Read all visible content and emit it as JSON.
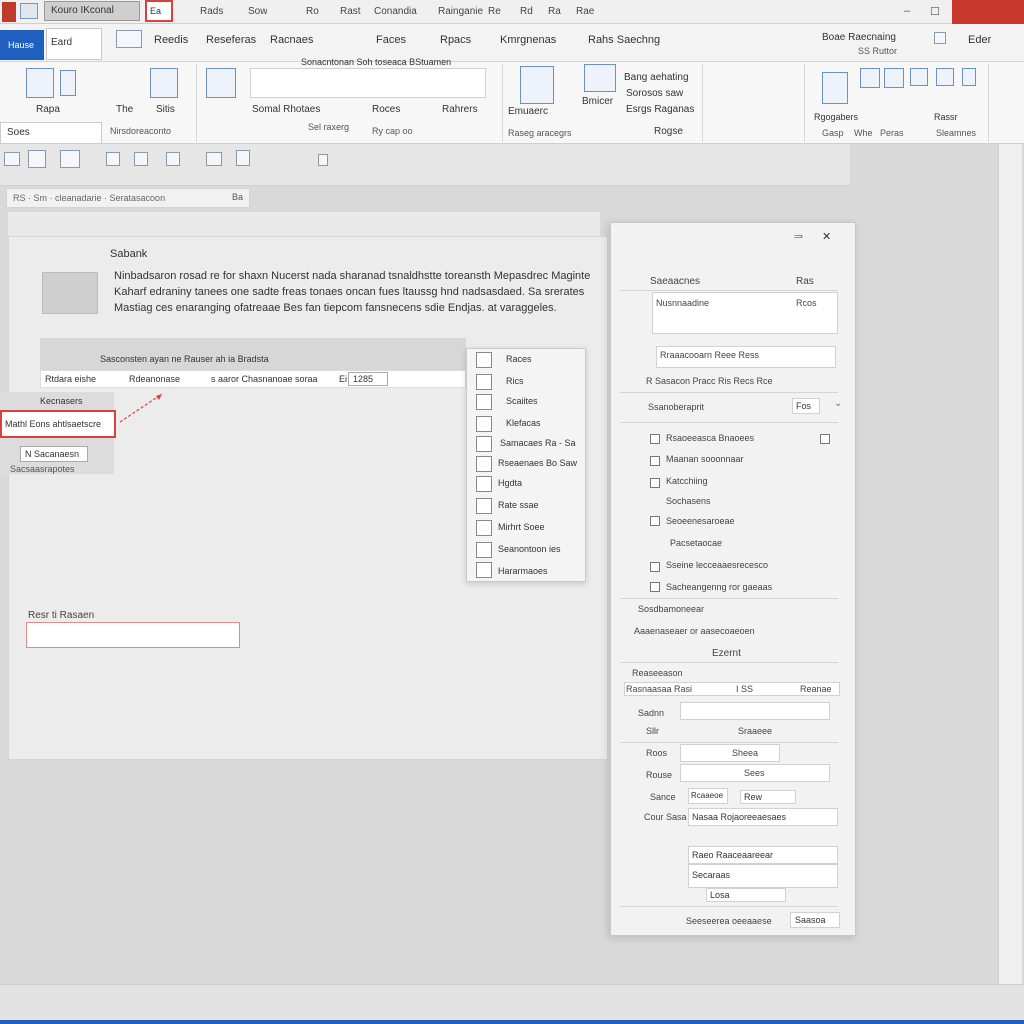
{
  "titlebar": {
    "doc_title": "Kouro IKconal",
    "highlight_btn": "Ea",
    "menus": [
      "Rads",
      "Sow",
      "Ro",
      "Rast",
      "Conandia",
      "Rainganie",
      "Re",
      "Rd",
      "Ra",
      "Rae"
    ],
    "min": "‒",
    "max": "☐"
  },
  "tabs": {
    "file": "Hause",
    "active": "Eard",
    "items": [
      "Reedis",
      "Reseferas",
      "Racnaes",
      "Faces",
      "Rpacs",
      "Kmrgnenas",
      "Rahs Saechng",
      "Eder"
    ],
    "right_group": "Boae Raecnaing",
    "right_sub": "SS Ruttor"
  },
  "ribbon": {
    "labels": [
      "Rapa",
      "The",
      "Sitis",
      "Somal Rhotaes",
      "Roces",
      "Rahrers",
      "Emuaerc",
      "Bmicer",
      "Rgogabers",
      "Rassr"
    ],
    "search": "Soes",
    "bottom_labels": [
      "Nirsdoreaconto",
      "Sel raxerg",
      "Ry cap oo",
      "Raseg aracegrs",
      "Gasp",
      "Whe",
      "Peras",
      "Sleamnes"
    ],
    "center_doc": "Sonacntonan Soh toseaca BStuamen",
    "right_labels": [
      "Bang aehating",
      "Sorosos saw",
      "Esrgs Raganas",
      "Rogse"
    ]
  },
  "toolbar2": {
    "breadcrumb": "RS · Sm · cleanadarie · Seratasacoon",
    "breadcrumb_end": "Ba"
  },
  "document": {
    "heading": "Sabank",
    "paragraphs": [
      "Ninbadsaron rosad re for shaxn Nucerst nada sharanad tsnaldhstte toreansth Mepasdrec Maginte",
      "Kaharf edraniny tanees one sadte freas tonaes oncan fues ltaussg hnd nadsasdaed. Sa srerates",
      "Mastiag ces enaranging ofatreaae Bes fan tiepcom fansnecens sdie Endjas. at varaggeles."
    ],
    "table_header": "Sasconsten ayan ne Rauser ah ia Bradsta",
    "table_row": [
      "Rtdara eishe",
      "Rdeanonase",
      "s aaror Chasnanoae soraa",
      "Ei"
    ],
    "table_value": "1285",
    "sidebox_label": "Kecnasers",
    "selected": "Mathl Eons ahtlsaetscre",
    "sidebox_btn": "N Sacanaesn",
    "sidebox_foot": "Sacsaasrapotes",
    "bottom_label": "Resr ti Rasaen"
  },
  "menu": {
    "items": [
      "Races",
      "Rics",
      "Scaiites",
      "Klefacas",
      "Samacaes Ra - Sa",
      "Rseaenaes Bo Saw",
      "Hgdta",
      "Rate ssae",
      "Mirhrt Soee",
      "Seanontoon ies",
      "Hararmaoes"
    ]
  },
  "panel": {
    "title": "Saeaacnes",
    "title_right": "Ras",
    "field1_label": "Nusnnaadine",
    "field1_right": "Rcos",
    "row2": "Rraaacooarn Reee Ress",
    "row3": "R Sasacon Pracc Ris Recs Rce",
    "select1": "Ssanoberaprit",
    "select1_val": "Fos",
    "list": [
      "Rsaoeeasca Bnaoees",
      "Maanan sooonnaar",
      "Katcchiing",
      "Sochasens",
      "Seoeenesaroeae",
      "Pacsetaocae",
      "Sseine lecceaaesrecesco",
      "Sacheangenng ror gaeaas"
    ],
    "section": "Sosdbamoneear",
    "section2": "Aaaenaseaer or aasecoaeoen",
    "header": "Ezernt",
    "sub": "Reaseeason",
    "row_a": "Rasnaasaa Rasi",
    "row_a_val": "I SS",
    "row_a_right": "Reanae",
    "lab_b": "Sadnn",
    "lab_c": "Sllr",
    "val_c": "Sraaeee",
    "lab_d": "Roos",
    "val_d": "Sheea",
    "lab_e": "Rouse",
    "val_e": "Sees",
    "lab_f": "Sance",
    "val_f1": "Rcaaeoe",
    "val_f2": "Rew",
    "lab_g": "Cour Sasa",
    "val_g": "Nasaa Rojaoreeaesaes",
    "val_h": "Raeo Raaceaareear",
    "val_i": "Secaraas",
    "val_j": "Losa",
    "footer": "Seeseerea oeeaaese",
    "footer_btn": "Saasoa"
  },
  "colors": {
    "accent": "#1f5fbf",
    "close": "#c9392e",
    "highlight": "#d94040"
  }
}
